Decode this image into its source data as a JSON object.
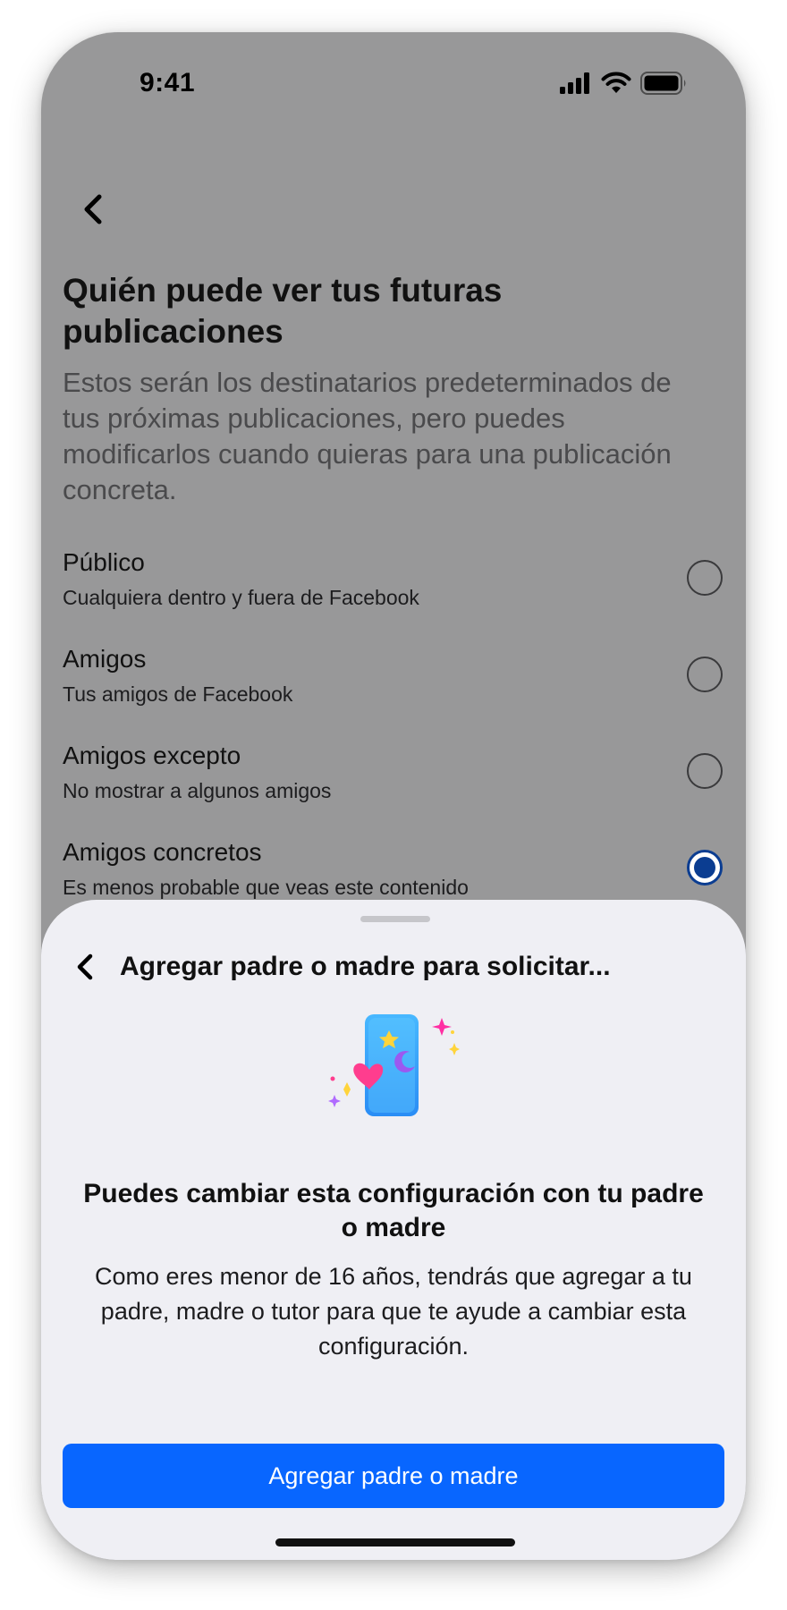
{
  "status_bar": {
    "time": "9:41",
    "icons": [
      "cellular-signal-icon",
      "wifi-icon",
      "battery-icon"
    ]
  },
  "page": {
    "back_icon": "chevron-left-icon",
    "title": "Quién puede ver tus futuras publicaciones",
    "description": "Estos serán los destinatarios predeterminados de tus próximas publicaciones, pero puedes modificarlos cuando quieras para una publicación concreta.",
    "options": [
      {
        "title": "Público",
        "subtitle": "Cualquiera dentro y fuera de Facebook",
        "selected": false
      },
      {
        "title": "Amigos",
        "subtitle": "Tus amigos de Facebook",
        "selected": false
      },
      {
        "title": "Amigos excepto",
        "subtitle": "No mostrar a algunos amigos",
        "selected": false
      },
      {
        "title": "Amigos concretos",
        "subtitle": "Es menos probable que veas este contenido",
        "selected": true
      }
    ]
  },
  "sheet": {
    "back_icon": "chevron-left-icon",
    "title": "Agregar padre o madre para solicitar...",
    "illustration": "phone-sparkles-illustration",
    "heading": "Puedes cambiar esta configuración con tu padre o madre",
    "body": "Como eres menor de 16 años, tendrás que agregar a tu padre, madre o tutor para que te ayude a cambiar esta configuración.",
    "primary_button": "Agregar padre o madre"
  },
  "colors": {
    "overlay_background": "#989899",
    "sheet_background": "#efeff4",
    "primary": "#0866ff",
    "radio_selected": "#0b3d91"
  }
}
